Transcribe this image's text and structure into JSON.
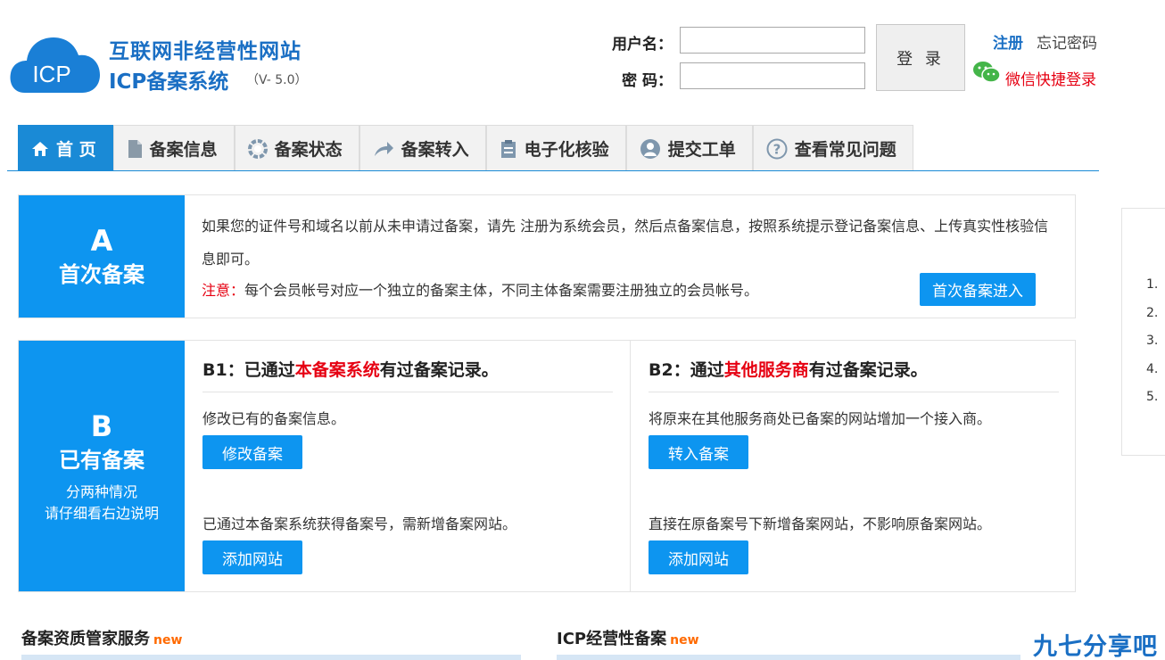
{
  "header": {
    "logo_title_1": "互联网非经营性网站",
    "logo_title_2": "ICP备案系统",
    "logo_badge": "ICP",
    "version": "（V- 5.0）",
    "username_label": "用户名：",
    "password_label": "密 码：",
    "login_label": "登 录",
    "register_label": "注册",
    "forgot_label": "忘记密码",
    "wechat_label": "微信快捷登录"
  },
  "nav": {
    "items": [
      {
        "label": "首 页",
        "icon": "home-icon",
        "active": true
      },
      {
        "label": "备案信息",
        "icon": "document-icon"
      },
      {
        "label": "备案状态",
        "icon": "status-icon"
      },
      {
        "label": "备案转入",
        "icon": "transfer-arrow-icon"
      },
      {
        "label": "电子化核验",
        "icon": "clipboard-icon"
      },
      {
        "label": "提交工单",
        "icon": "user-icon"
      },
      {
        "label": "查看常见问题",
        "icon": "question-icon"
      }
    ]
  },
  "section_a": {
    "letter": "A",
    "title": "首次备案",
    "text": "如果您的证件号和域名以前从未申请过备案，请先 注册为系统会员，然后点备案信息，按照系统提示登记备案信息、上传真实性核验信息即可。",
    "note_prefix": "注意：",
    "note": "每个会员帐号对应一个独立的备案主体，不同主体备案需要注册独立的会员帐号。",
    "button": "首次备案进入"
  },
  "section_b": {
    "letter": "B",
    "title": "已有备案",
    "sub1": "分两种情况",
    "sub2": "请仔细看右边说明",
    "b1": {
      "head_pre": "B1：已通过",
      "head_red": "本备案系统",
      "head_post": "有过备案记录。",
      "text1": "修改已有的备案信息。",
      "btn1": "修改备案",
      "text2": "已通过本备案系统获得备案号，需新增备案网站。",
      "btn2": "添加网站"
    },
    "b2": {
      "head_pre": "B2：通过",
      "head_red": "其他服务商",
      "head_post": "有过备案记录。",
      "text1": "将原来在其他服务商处已备案的网站增加一个接入商。",
      "btn1": "转入备案",
      "text2": "直接在原备案号下新增备案网站，不影响原备案网站。",
      "btn2": "添加网站"
    }
  },
  "bottom": {
    "h1": "备案资质管家服务",
    "h2": "ICP经营性备案",
    "new_tag": "new"
  },
  "right_panel": {
    "items": [
      "1.",
      "2.",
      "3.",
      "4.",
      "5."
    ]
  },
  "watermark": "九七分享吧",
  "colors": {
    "primary": "#0d95f0",
    "brand": "#1a6fc4",
    "red": "#e60012",
    "new": "#ff6a00"
  }
}
